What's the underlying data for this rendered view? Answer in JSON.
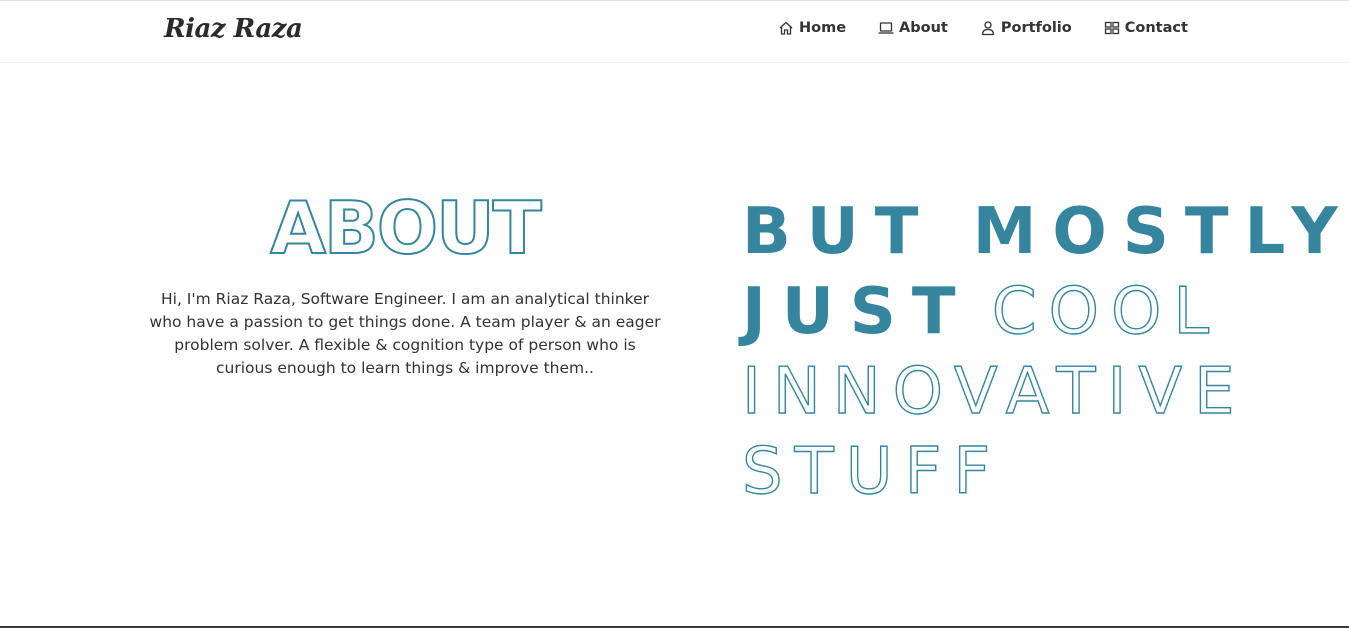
{
  "brand": {
    "name": "Riaz Raza"
  },
  "nav": {
    "items": [
      {
        "label": "Home",
        "icon": "home-icon"
      },
      {
        "label": "About",
        "icon": "laptop-icon"
      },
      {
        "label": "Portfolio",
        "icon": "user-icon"
      },
      {
        "label": "Contact",
        "icon": "grid-icon"
      }
    ]
  },
  "about": {
    "heading": "ABOUT",
    "description": "Hi, I'm Riaz Raza, Software Engineer. I am an analytical thinker who have a passion to get things done. A team player & an eager problem solver. A flexible & cognition type of person who is curious enough to learn things & improve them.."
  },
  "tagline": {
    "line1_bold": "BUT MOSTLY",
    "line2_bold": "JUST",
    "line2_thin": "COOL",
    "line3_thin": "INNOVATIVE",
    "line4_thin": "STUFF"
  },
  "colors": {
    "accent": "#35859f",
    "text": "#333333",
    "background": "#ffffff"
  }
}
